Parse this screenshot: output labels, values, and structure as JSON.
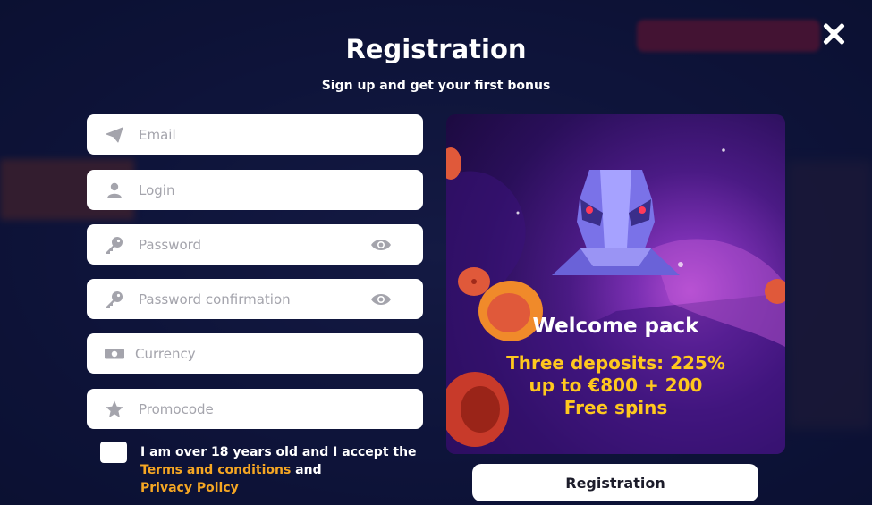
{
  "modal": {
    "title": "Registration",
    "subtitle": "Sign up and get your first bonus"
  },
  "form": {
    "email": {
      "placeholder": "Email",
      "icon": "paper-plane-icon"
    },
    "login": {
      "placeholder": "Login",
      "icon": "user-icon"
    },
    "password": {
      "placeholder": "Password",
      "icon": "key-icon"
    },
    "password_confirmation": {
      "placeholder": "Password confirmation",
      "icon": "key-icon"
    },
    "currency": {
      "placeholder": "Currency",
      "icon": "money-icon"
    },
    "promocode": {
      "placeholder": "Promocode",
      "icon": "star-icon"
    },
    "agreement": {
      "text_1": "I am over 18 years old and I accept the ",
      "terms_link": "Terms and conditions",
      "text_2": " and ",
      "privacy_link": "Privacy Policy"
    },
    "submit_label": "Registration"
  },
  "promo": {
    "title": "Welcome pack",
    "offer_lines": [
      "Three deposits: 225%",
      "up to €800 + 200",
      "Free spins"
    ]
  },
  "colors": {
    "accent": "#f5a623",
    "offer": "#ffc81e",
    "background": "#141a48"
  }
}
